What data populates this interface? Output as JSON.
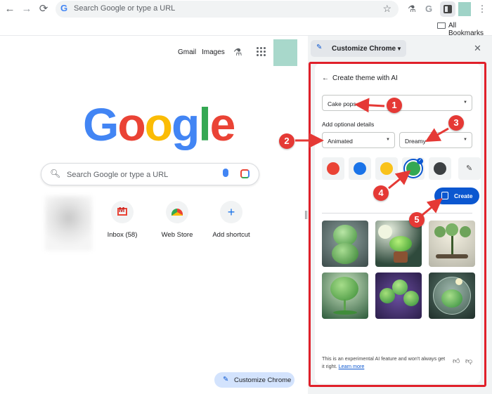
{
  "toolbar": {
    "omnibox_placeholder": "Search Google or type a URL",
    "back_icon": "arrow-left-icon",
    "forward_icon": "arrow-right-icon",
    "reload_icon": "reload-icon"
  },
  "bookmarks": {
    "all_bookmarks": "All Bookmarks"
  },
  "page": {
    "gmail_link": "Gmail",
    "images_link": "Images",
    "search_placeholder": "Search Google or type a URL",
    "shortcuts": [
      {
        "label": "Inbox (58)"
      },
      {
        "label": "Web Store"
      },
      {
        "label": "Add shortcut"
      }
    ],
    "customize_button": "Customize Chrome"
  },
  "logo": {
    "letters": [
      "G",
      "o",
      "o",
      "g",
      "l",
      "e"
    ],
    "colors": [
      "#4285F4",
      "#EA4335",
      "#FBBC05",
      "#4285F4",
      "#34A853",
      "#EA4335"
    ]
  },
  "panel": {
    "header_button": "Customize Chrome",
    "title": "Create theme with AI",
    "subject_value": "Cake pops",
    "optional_label": "Add optional details",
    "style_value": "Animated",
    "mood_value": "Dreamy",
    "swatch_colors": [
      "#EA4335",
      "#1A73E8",
      "#F9C21A",
      "#34A853",
      "#3C4043"
    ],
    "selected_swatch": 3,
    "create_button": "Create",
    "disclaimer": "This is an experimental AI feature and won't always get it right.",
    "learn_more": "Learn more"
  },
  "annotations": {
    "badges": [
      "1",
      "2",
      "3",
      "4",
      "5"
    ],
    "highlight_color": "#E0202A"
  }
}
